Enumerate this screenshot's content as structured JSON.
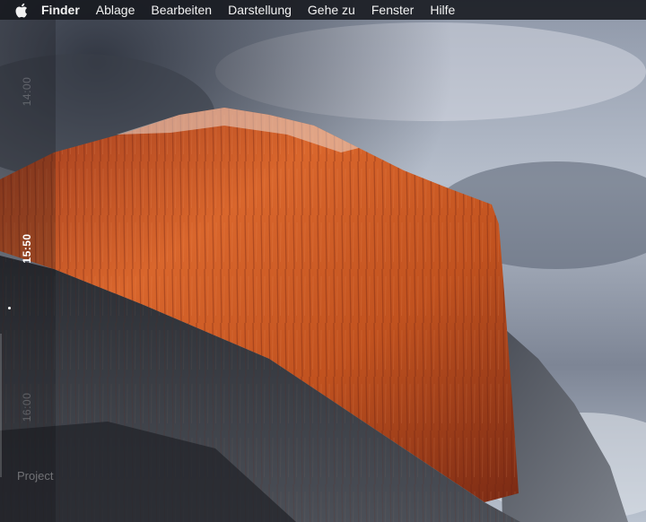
{
  "menubar": {
    "apple_icon": "apple-logo-icon",
    "app_name": "Finder",
    "items": [
      "Ablage",
      "Bearbeiten",
      "Darstellung",
      "Gehe zu",
      "Fenster",
      "Hilfe"
    ]
  },
  "timeline": {
    "times": [
      "14:00",
      "15:50",
      "16:00"
    ],
    "current_time": "15:50",
    "project_label": "Project"
  },
  "colors": {
    "menubar_bg": "#16181e",
    "rock_lit": "#c85a24",
    "sky": "#9aa3b4"
  }
}
